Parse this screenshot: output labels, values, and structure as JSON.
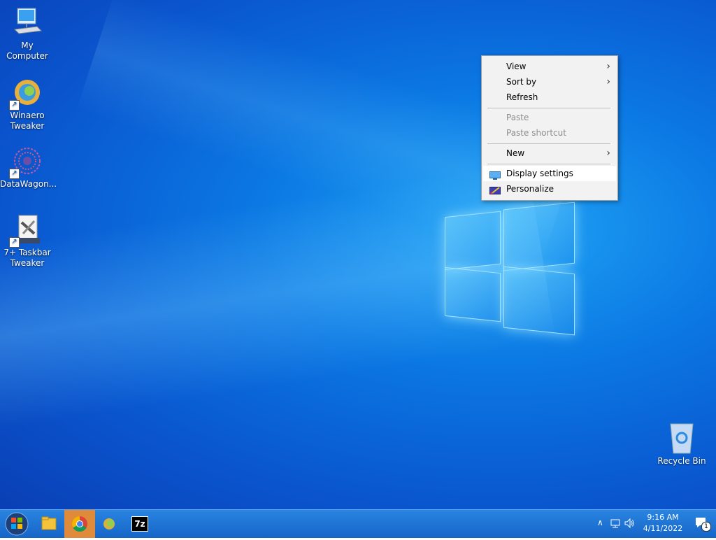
{
  "desktop": {
    "icons": [
      {
        "label": "My Computer"
      },
      {
        "label": "Winaero Tweaker"
      },
      {
        "label": "DataWagon..."
      },
      {
        "label": "7+ Taskbar Tweaker"
      },
      {
        "label": "Recycle Bin"
      }
    ]
  },
  "context_menu": {
    "items": [
      {
        "label": "View",
        "submenu": true,
        "enabled": true
      },
      {
        "label": "Sort by",
        "submenu": true,
        "enabled": true
      },
      {
        "label": "Refresh",
        "submenu": false,
        "enabled": true
      },
      {
        "label": "Paste",
        "submenu": false,
        "enabled": false
      },
      {
        "label": "Paste shortcut",
        "submenu": false,
        "enabled": false
      },
      {
        "label": "New",
        "submenu": true,
        "enabled": true
      },
      {
        "label": "Display settings",
        "submenu": false,
        "enabled": true,
        "icon": "monitor-icon",
        "highlighted": true
      },
      {
        "label": "Personalize",
        "submenu": false,
        "enabled": true,
        "icon": "personalize-icon"
      }
    ]
  },
  "taskbar": {
    "apps": [
      {
        "icon": "start-orb-icon"
      },
      {
        "icon": "file-explorer-icon"
      },
      {
        "icon": "chrome-icon",
        "active": true
      },
      {
        "icon": "winaero-tweaker-icon"
      },
      {
        "icon": "7zip-icon",
        "text": "7z"
      }
    ],
    "tray": {
      "time": "9:16 AM",
      "date": "4/11/2022",
      "notification_count": "1",
      "icons": [
        "chevron-up-icon",
        "network-icon",
        "volume-icon",
        "action-center-icon"
      ]
    }
  },
  "colors": {
    "desktop_blue": "#0a6fe0",
    "taskbar_blue": "#1b6fd0",
    "menu_bg": "#f2f2f2",
    "active_app_bg": "#e08a3c"
  }
}
